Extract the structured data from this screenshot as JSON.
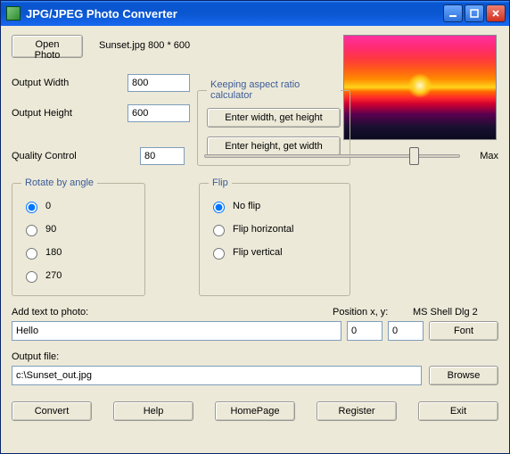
{
  "titlebar": {
    "title": "JPG/JPEG Photo Converter"
  },
  "open_btn": "Open Photo",
  "file_info": "Sunset.jpg 800 * 600",
  "width_label": "Output Width",
  "width_value": "800",
  "height_label": "Output Height",
  "height_value": "600",
  "keeping": {
    "legend": "Keeping aspect ratio calculator",
    "btn_width": "Enter width, get height",
    "btn_height": "Enter height, get width"
  },
  "quality": {
    "label": "Quality Control",
    "value": "80",
    "max": "Max",
    "percent": 80
  },
  "rotate": {
    "legend": "Rotate by angle",
    "options": [
      "0",
      "90",
      "180",
      "270"
    ],
    "selected": "0"
  },
  "flip": {
    "legend": "Flip",
    "options": [
      "No flip",
      "Flip horizontal",
      "Flip vertical"
    ],
    "selected": "No flip"
  },
  "addtext": {
    "label": "Add text to photo:",
    "value": "Hello",
    "pos_label": "Position x, y:",
    "x": "0",
    "y": "0",
    "font_display": "MS Shell Dlg 2",
    "font_btn": "Font"
  },
  "output": {
    "label": "Output file:",
    "value": "c:\\Sunset_out.jpg",
    "browse": "Browse"
  },
  "bottom": {
    "convert": "Convert",
    "help": "Help",
    "homepage": "HomePage",
    "register": "Register",
    "exit": "Exit"
  }
}
